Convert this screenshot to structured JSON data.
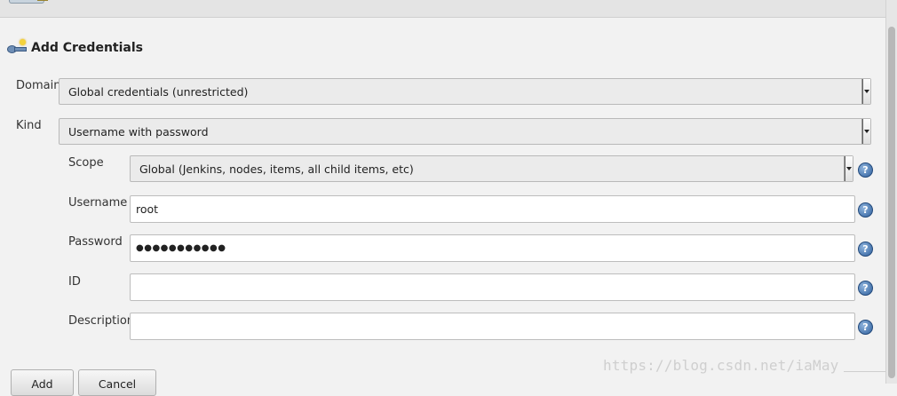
{
  "header": {
    "title": "Add Credentials"
  },
  "form": {
    "domain": {
      "label": "Domain",
      "value": "Global credentials (unrestricted)"
    },
    "kind": {
      "label": "Kind",
      "value": "Username with password"
    },
    "scope": {
      "label": "Scope",
      "value": "Global (Jenkins, nodes, items, all child items, etc)"
    },
    "username": {
      "label": "Username",
      "value": "root"
    },
    "password": {
      "label": "Password",
      "value": "●●●●●●●●●●●"
    },
    "id": {
      "label": "ID",
      "value": ""
    },
    "description": {
      "label": "Description",
      "value": ""
    }
  },
  "help_glyph": "?",
  "buttons": {
    "add_label": "Add",
    "cancel_label": "Cancel"
  },
  "watermark": "https://blog.csdn.net/iaMay",
  "colors": {
    "help_icon": "#2e5f9c",
    "background": "#f2f2f2"
  }
}
